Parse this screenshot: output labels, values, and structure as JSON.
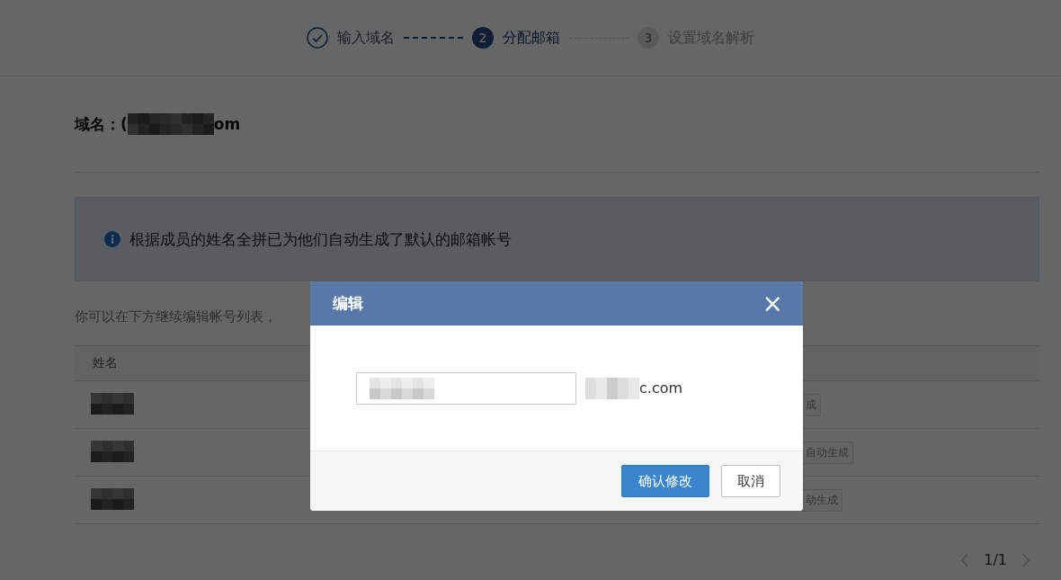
{
  "steps": [
    {
      "label": "输入域名",
      "done": true,
      "selected": false
    },
    {
      "number": "2",
      "label": "分配邮箱",
      "done": false,
      "selected": true
    },
    {
      "number": "3",
      "label": "设置域名解析",
      "done": false,
      "selected": false
    }
  ],
  "domain": {
    "label": "域名：(",
    "value_tail": "om"
  },
  "info": {
    "text": "根据成员的姓名全拼已为他们自动生成了默认的邮箱帐号"
  },
  "hint": "你可以在下方继续编辑帐号列表，",
  "table": {
    "columns": [
      "姓名"
    ],
    "rows": [
      {
        "tag": "成"
      },
      {
        "tag": "自动生成"
      },
      {
        "tag": "动生成"
      }
    ]
  },
  "pagination": {
    "page": "1/1"
  },
  "dialog": {
    "title": "编辑",
    "close": "×",
    "suffix": "c.com",
    "buttons": [
      {
        "label": "确认修改",
        "kind": "primary"
      },
      {
        "label": "取消",
        "kind": "default"
      }
    ]
  }
}
